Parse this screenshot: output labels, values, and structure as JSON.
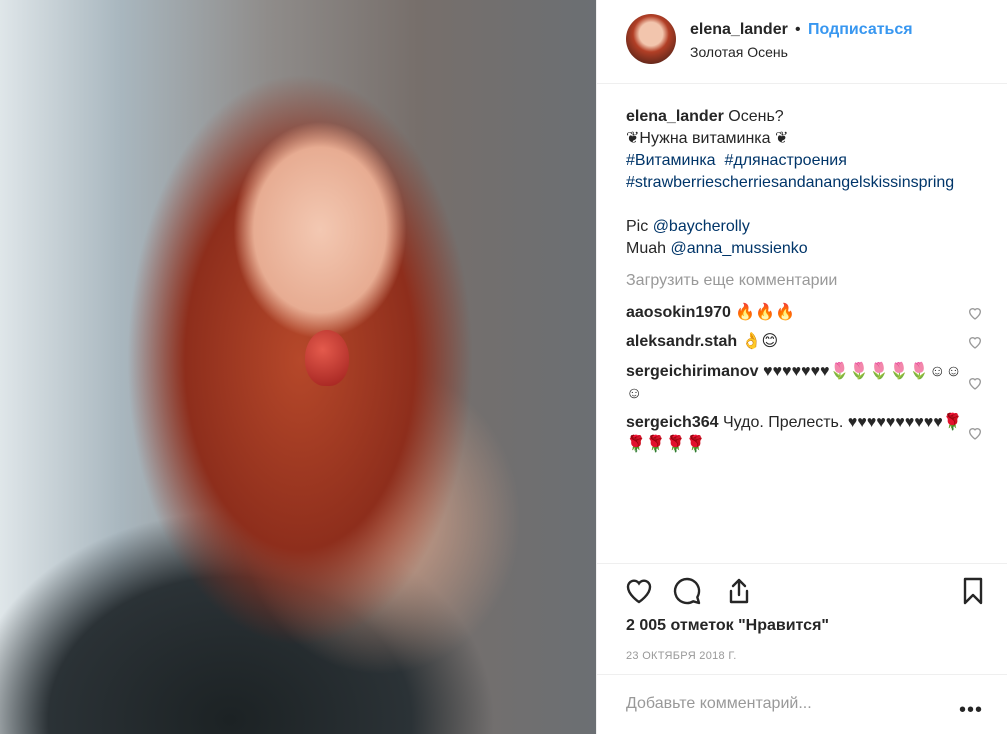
{
  "header": {
    "username": "elena_lander",
    "bullet": "•",
    "follow_label": "Подписаться",
    "location": "Золотая Осень"
  },
  "caption": {
    "username": "elena_lander",
    "line1": "Осень?",
    "line2": "❦Нужна витаминка ❦",
    "tag1": "#Витаминка",
    "tag2": "#длянастроения",
    "tag3": "#strawberriescherriesandanangelskissinspring",
    "pic_prefix": "Pic",
    "pic_mention": "@baycherolly",
    "muah_prefix": "Muah",
    "muah_mention": "@anna_mussienko"
  },
  "load_more_label": "Загрузить еще комментарии",
  "comments": [
    {
      "user": "aaosokin1970",
      "text": "🔥🔥🔥"
    },
    {
      "user": "aleksandr.stah",
      "text": "👌😊"
    },
    {
      "user": "sergeichirimanov",
      "text": "♥♥♥♥♥♥♥🌷🌷🌷🌷🌷☺☺☺"
    },
    {
      "user": "sergeich364",
      "text": "Чудо. Прелесть. ♥♥♥♥♥♥♥♥♥♥🌹🌹🌹🌹🌹"
    }
  ],
  "likes_label": "2 005 отметок \"Нравится\"",
  "date_label": "23 ОКТЯБРЯ 2018 Г.",
  "comment_placeholder": "Добавьте комментарий...",
  "more_label": "•••",
  "icons": {
    "like": "heart-icon",
    "comment": "comment-bubble-icon",
    "share": "share-icon",
    "save": "bookmark-icon",
    "comment_like": "small-heart-icon"
  },
  "colors": {
    "link": "#003569",
    "follow": "#3897f0",
    "muted": "#999999",
    "text": "#262626"
  }
}
